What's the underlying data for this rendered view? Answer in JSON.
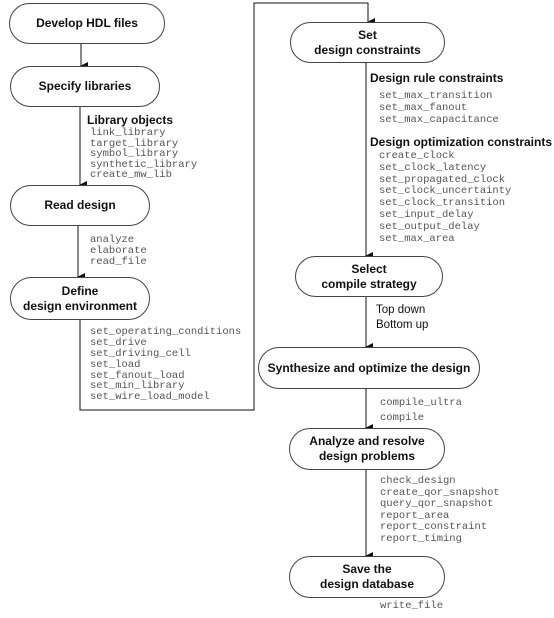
{
  "steps": {
    "develop": {
      "lines": [
        "Develop HDL files"
      ]
    },
    "libraries": {
      "lines": [
        "Specify libraries"
      ]
    },
    "read": {
      "lines": [
        "Read design"
      ]
    },
    "environment": {
      "lines": [
        "Define",
        "design environment"
      ]
    },
    "constraints": {
      "lines": [
        "Set",
        "design constraints"
      ]
    },
    "strategy": {
      "lines": [
        "Select",
        "compile strategy"
      ]
    },
    "synthesize": {
      "lines": [
        "Synthesize and optimize the design"
      ]
    },
    "analyze": {
      "lines": [
        "Analyze and resolve",
        "design problems"
      ]
    },
    "save": {
      "lines": [
        "Save the",
        "design database"
      ]
    }
  },
  "annotations": {
    "library_objects": {
      "heading": "Library objects",
      "commands": [
        "link_library",
        "target_library",
        "symbol_library",
        "synthetic_library",
        "create_mw_lib"
      ]
    },
    "read_commands": [
      "analyze",
      "elaborate",
      "read_file"
    ],
    "environment_commands": [
      "set_operating_conditions",
      "set_drive",
      "set_driving_cell",
      "set_load",
      "set_fanout_load",
      "set_min_library",
      "set_wire_load_model"
    ],
    "design_rule": {
      "heading": "Design rule constraints",
      "commands": [
        "set_max_transition",
        "set_max_fanout",
        "set_max_capacitance"
      ]
    },
    "design_optimization": {
      "heading": "Design optimization constraints",
      "commands": [
        "create_clock",
        "set_clock_latency",
        "set_propagated_clock",
        "set_clock_uncertainty",
        "set_clock_transition",
        "set_input_delay",
        "set_output_delay",
        "set_max_area"
      ]
    },
    "strategies": [
      "Top down",
      "Bottom up"
    ],
    "compile_commands": [
      "compile_ultra",
      "compile"
    ],
    "analysis_commands": [
      "check_design",
      "create_qor_snapshot",
      "query_qor_snapshot",
      "report_area",
      "report_constraint",
      "report_timing"
    ],
    "save_commands": [
      "write_file"
    ]
  }
}
